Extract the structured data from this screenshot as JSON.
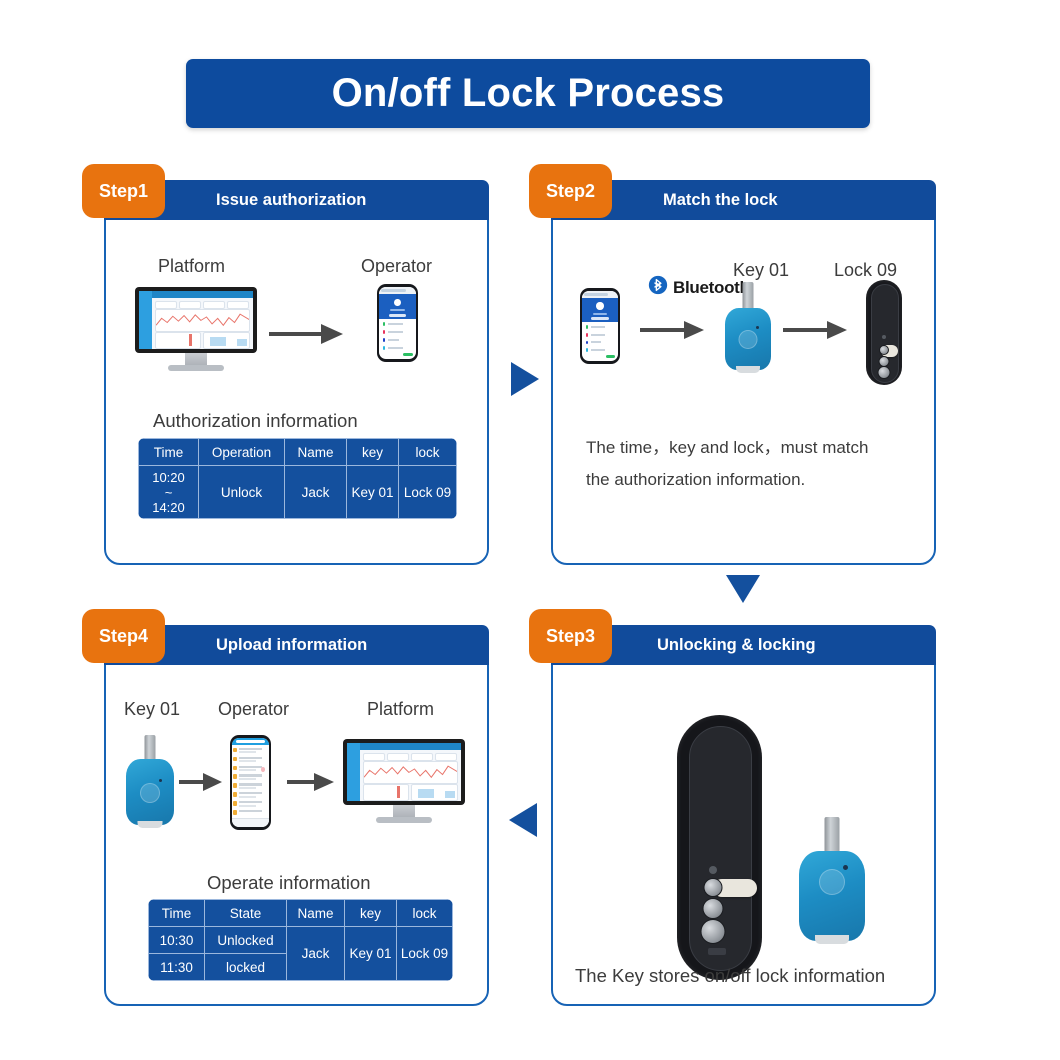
{
  "page": {
    "title": "On/off Lock Process",
    "background_color": "#ffffff",
    "accent_blue": "#0d4b9e",
    "accent_orange": "#e8730f",
    "border_blue": "#1763b5"
  },
  "steps": [
    {
      "badge": "Step1",
      "title": "Issue authorization",
      "labels": {
        "left": "Platform",
        "right": "Operator"
      },
      "caption": "Authorization information",
      "table": {
        "headers": [
          "Time",
          "Operation",
          "Name",
          "key",
          "lock"
        ],
        "rows": [
          {
            "time": "10:20\n~\n14:20",
            "operation": "Unlock",
            "name": "Jack",
            "key": "Key 01",
            "lock": "Lock 09"
          }
        ]
      }
    },
    {
      "badge": "Step2",
      "title": "Match the lock",
      "labels": {
        "key": "Key 01",
        "lock": "Lock 09"
      },
      "bluetooth_label": "Bluetooth",
      "body_line1": "The time，key and lock，must match",
      "body_line2": "the authorization information."
    },
    {
      "badge": "Step3",
      "title": "Unlocking &  locking",
      "caption": "The Key stores on/off lock information"
    },
    {
      "badge": "Step4",
      "title": "Upload information",
      "labels": {
        "key": "Key 01",
        "operator": "Operator",
        "platform": "Platform"
      },
      "caption": "Operate information",
      "table": {
        "headers": [
          "Time",
          "State",
          "Name",
          "key",
          "lock"
        ],
        "rows": [
          {
            "time": "10:30",
            "state": "Unlocked"
          },
          {
            "time": "11:30",
            "state": "locked"
          }
        ],
        "merged": {
          "name": "Jack",
          "key": "Key 01",
          "lock": "Lock 09"
        }
      }
    }
  ],
  "flow_arrows": [
    {
      "name": "step1-to-step2",
      "direction": "right",
      "color": "#14509e"
    },
    {
      "name": "step2-to-step3",
      "direction": "down",
      "color": "#14509e"
    },
    {
      "name": "step3-to-step4",
      "direction": "left",
      "color": "#14509e"
    }
  ],
  "icons": {
    "bluetooth": "bluetooth-icon",
    "monitor": "monitor-icon",
    "phone": "phone-icon",
    "keyfob": "key-fob-icon",
    "lock": "smart-lock-icon",
    "arrow_right": "arrow-right-icon"
  }
}
